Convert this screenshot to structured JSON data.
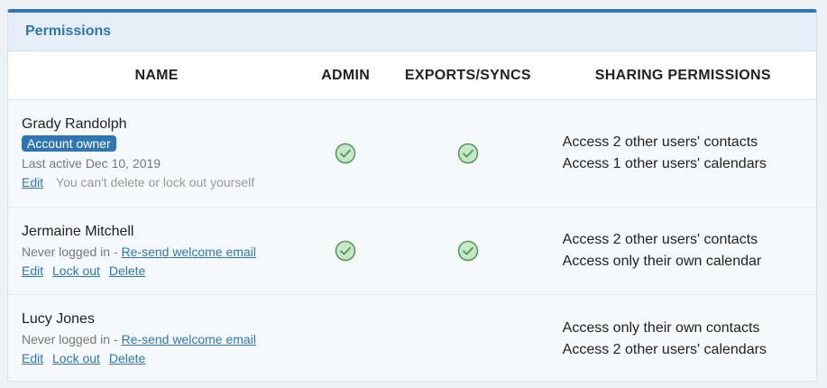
{
  "panel": {
    "title": "Permissions"
  },
  "columns": {
    "name": "NAME",
    "admin": "ADMIN",
    "exports": "EXPORTS/SYNCS",
    "sharing": "SHARING PERMISSIONS"
  },
  "users": [
    {
      "name": "Grady Randolph",
      "badge": "Account owner",
      "status": "Last active Dec 10, 2019",
      "edit": "Edit",
      "note": "You can't delete or lock out yourself",
      "admin": true,
      "exports": true,
      "sharing": [
        "Access 2 other users' contacts",
        "Access 1 other users' calendars"
      ]
    },
    {
      "name": "Jermaine Mitchell",
      "status": "Never logged in - ",
      "resend": "Re-send welcome email",
      "edit": "Edit",
      "lockout": "Lock out",
      "delete": "Delete",
      "admin": true,
      "exports": true,
      "sharing": [
        "Access 2 other users' contacts",
        "Access only their own calendar"
      ]
    },
    {
      "name": "Lucy Jones",
      "status": "Never logged in - ",
      "resend": "Re-send welcome email",
      "edit": "Edit",
      "lockout": "Lock out",
      "delete": "Delete",
      "admin": false,
      "exports": false,
      "sharing": [
        "Access only their own contacts",
        "Access 2 other users' calendars"
      ]
    }
  ],
  "icons": {
    "check": "check-circle-icon"
  },
  "colors": {
    "accent": "#2f77b3",
    "check_fill": "#c8e6c9",
    "check_stroke": "#4c9a52"
  }
}
